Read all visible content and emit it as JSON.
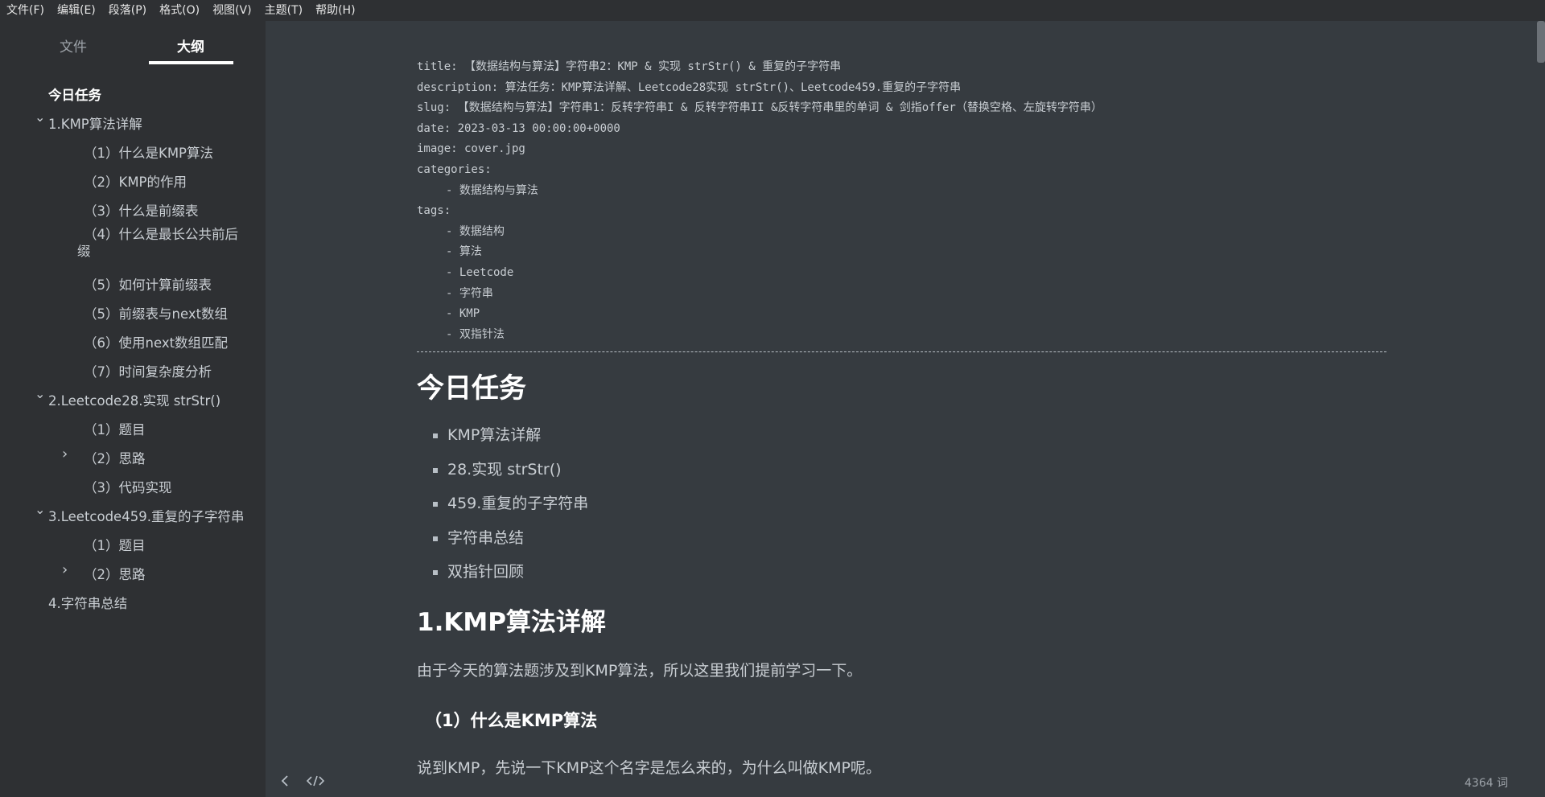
{
  "menu": {
    "items": [
      "文件(F)",
      "编辑(E)",
      "段落(P)",
      "格式(O)",
      "视图(V)",
      "主题(T)",
      "帮助(H)"
    ]
  },
  "sidebar": {
    "tab_files": "文件",
    "tab_outline": "大纲",
    "outline": [
      {
        "label": "今日任务",
        "level": 1,
        "chevron": "",
        "bold": true
      },
      {
        "label": "1.KMP算法详解",
        "level": 1,
        "chevron": "down"
      },
      {
        "label": "（1）什么是KMP算法",
        "level": 2,
        "chevron": ""
      },
      {
        "label": "（2）KMP的作用",
        "level": 2,
        "chevron": ""
      },
      {
        "label": "（3）什么是前缀表",
        "level": 2,
        "chevron": ""
      },
      {
        "label": "（4）什么是最长公共前后缀",
        "level": 2,
        "chevron": "",
        "wrap": true
      },
      {
        "label": "（5）如何计算前缀表",
        "level": 2,
        "chevron": ""
      },
      {
        "label": "（5）前缀表与next数组",
        "level": 2,
        "chevron": ""
      },
      {
        "label": "（6）使用next数组匹配",
        "level": 2,
        "chevron": ""
      },
      {
        "label": "（7）时间复杂度分析",
        "level": 2,
        "chevron": ""
      },
      {
        "label": "2.Leetcode28.实现 strStr()",
        "level": 1,
        "chevron": "down"
      },
      {
        "label": "（1）题目",
        "level": 2,
        "chevron": ""
      },
      {
        "label": "（2）思路",
        "level": 2,
        "chevron": "right"
      },
      {
        "label": "（3）代码实现",
        "level": 2,
        "chevron": ""
      },
      {
        "label": "3.Leetcode459.重复的子字符串",
        "level": 1,
        "chevron": "down"
      },
      {
        "label": "（1）题目",
        "level": 2,
        "chevron": ""
      },
      {
        "label": "（2）思路",
        "level": 2,
        "chevron": "right"
      },
      {
        "label": "4.字符串总结",
        "level": 1,
        "chevron": ""
      }
    ]
  },
  "doc": {
    "front_matter": {
      "title": "title: 【数据结构与算法】字符串2：KMP & 实现 strStr() & 重复的子字符串",
      "description": "description: 算法任务：KMP算法详解、Leetcode28实现 strStr()、Leetcode459.重复的子字符串",
      "slug": "slug: 【数据结构与算法】字符串1：反转字符串I & 反转字符串II &反转字符串里的单词 & 剑指offer（替换空格、左旋转字符串）",
      "date": "date: 2023-03-13 00:00:00+0000",
      "image": "image: cover.jpg",
      "categories_label": "categories:",
      "categories": [
        "- 数据结构与算法"
      ],
      "tags_label": "tags:",
      "tags": [
        "- 数据结构",
        "- 算法",
        "- Leetcode",
        "- 字符串",
        "- KMP",
        "- 双指针法"
      ]
    },
    "h1": "今日任务",
    "tasks": [
      "KMP算法详解",
      "28.实现 strStr()",
      "459.重复的子字符串",
      "字符串总结",
      "双指针回顾"
    ],
    "h2": "1.KMP算法详解",
    "p1": "由于今天的算法题涉及到KMP算法，所以这里我们提前学习一下。",
    "h3": "（1）什么是KMP算法",
    "p2": "说到KMP，先说一下KMP这个名字是怎么来的，为什么叫做KMP呢。"
  },
  "footer": {
    "word_count": "4364 词"
  },
  "colors": {
    "background": "#363b40",
    "sidebar": "#2e3033",
    "heading": "#ffffff",
    "text": "#c9ced3"
  }
}
